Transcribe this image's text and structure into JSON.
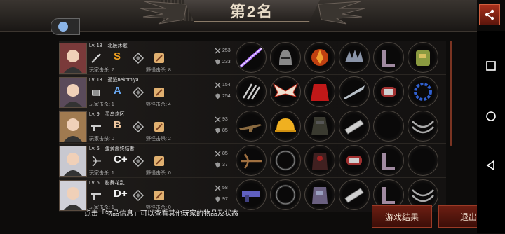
{
  "header": {
    "rank_title": "第2名"
  },
  "colors": {
    "grade_s": "#f0a020",
    "grade_a": "#6aa8f0",
    "grade_b": "#f0c8a0",
    "grade_c": "#f0f0f0",
    "grade_d": "#f0f0f0",
    "accent": "#7a1e10"
  },
  "players": [
    {
      "level": "Lv. 18",
      "name": "北辰沐歌",
      "grade": "S",
      "player_kills": "玩家击杀: 7",
      "monster_kills": "野怪击杀: 8",
      "attack": "253",
      "defense": "233",
      "weapon_icon": "sword-icon",
      "avatar_color": "#7a3a3a",
      "items": [
        "purple-lightsaber-icon",
        "knight-helmet-icon",
        "fire-armor-icon",
        "spiked-pauldron-icon",
        "boots-icon",
        "backpack-icon"
      ]
    },
    {
      "level": "Lv. 13",
      "name": "遁逃nekomiya",
      "grade": "A",
      "player_kills": "玩家击杀: 1",
      "monster_kills": "野怪击杀: 4",
      "attack": "154",
      "defense": "254",
      "weapon_icon": "fist-icon",
      "avatar_color": "#5a4a5a",
      "items": [
        "claw-icon",
        "wings-icon",
        "red-cape-icon",
        "blade-icon",
        "bracer-icon",
        "chain-icon"
      ]
    },
    {
      "level": "Lv. 9",
      "name": "灵岛炮区",
      "grade": "B",
      "player_kills": "玩家击杀: 0",
      "monster_kills": "野怪击杀: 2",
      "attack": "93",
      "defense": "85",
      "weapon_icon": "pistol-icon",
      "avatar_color": "#a07a50",
      "items": [
        "rifle-icon",
        "hard-hat-icon",
        "vest-icon",
        "gauntlet-icon",
        "empty-slot",
        "belt-icon"
      ]
    },
    {
      "level": "Lv. 6",
      "name": "蛋黄酱终结者",
      "grade": "C+",
      "player_kills": "玩家击杀: 1",
      "monster_kills": "野怪击杀: 0",
      "attack": "85",
      "defense": "37",
      "weapon_icon": "bow-icon",
      "avatar_color": "#c8c8d0",
      "items": [
        "crossbow-icon",
        "ring-icon",
        "dark-armor-icon",
        "bracer-icon",
        "boots-icon",
        "empty-slot"
      ]
    },
    {
      "level": "Lv. 6",
      "name": "影舞花乱",
      "grade": "D+",
      "player_kills": "玩家击杀: 1",
      "monster_kills": "野怪击杀: 0",
      "attack": "58",
      "defense": "97",
      "weapon_icon": "pistol-icon",
      "avatar_color": "#d0d0d8",
      "items": [
        "blaster-icon",
        "ring-icon",
        "mech-armor-icon",
        "gauntlet-icon",
        "boots-icon",
        "belt-icon"
      ]
    }
  ],
  "footer": {
    "hint": "点击「物品信息」可以查看其他玩家的物品及状态",
    "result_button": "游戏结果",
    "exit_button": "退出"
  }
}
